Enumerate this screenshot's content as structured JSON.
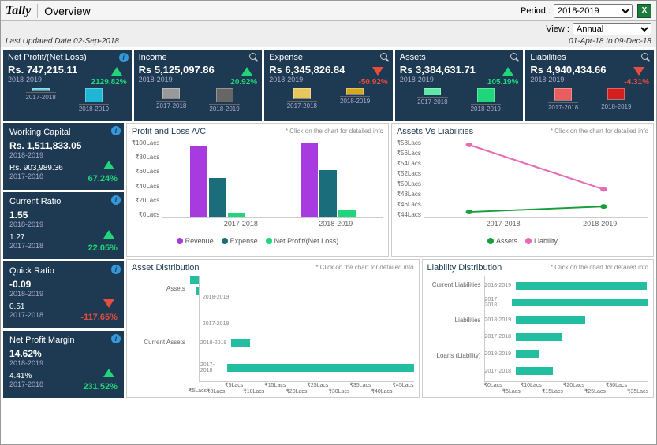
{
  "header": {
    "logo": "Tally",
    "title": "Overview",
    "period_label": "Period :",
    "period_value": "2018-2019",
    "view_label": "View :",
    "view_value": "Annual",
    "date_range": "01-Apr-18 to 09-Dec-18",
    "last_updated": "Last Updated Date 02-Sep-2018"
  },
  "top_cards": [
    {
      "title": "Net Profit/(Net Loss)",
      "value": "Rs. 747,215.11",
      "year": "2018-2019",
      "pct": "2129.82%",
      "dir": "up",
      "icon": "info",
      "bars": [
        {
          "label": "2017-2018",
          "h": 3,
          "color": "#5dd3e8"
        },
        {
          "label": "2018-2019",
          "h": 18,
          "color": "#1fb5d4"
        }
      ]
    },
    {
      "title": "Income",
      "value": "Rs 5,125,097.86",
      "year": "2018-2019",
      "pct": "20.92%",
      "dir": "up",
      "icon": "search",
      "bars": [
        {
          "label": "2017-2018",
          "h": 14,
          "color": "#999"
        },
        {
          "label": "2018-2019",
          "h": 18,
          "color": "#666"
        }
      ]
    },
    {
      "title": "Expense",
      "value": "Rs 6,345,826.84",
      "year": "2018-2019",
      "pct": "-50.92%",
      "dir": "down",
      "icon": "search",
      "bars": [
        {
          "label": "2017-2018",
          "h": 14,
          "color": "#e8c65d"
        },
        {
          "label": "2018-2019",
          "h": 8,
          "color": "#d4a81f"
        }
      ]
    },
    {
      "title": "Assets",
      "value": "Rs 3,384,631.71",
      "year": "2018-2019",
      "pct": "105.19%",
      "dir": "up",
      "icon": "search",
      "bars": [
        {
          "label": "2017-2018",
          "h": 9,
          "color": "#5de8a8"
        },
        {
          "label": "2018-2019",
          "h": 18,
          "color": "#1fd67a"
        }
      ]
    },
    {
      "title": "Liabilities",
      "value": "Rs 4,940,434.66",
      "year": "2018-2019",
      "pct": "-4.31%",
      "dir": "down",
      "icon": "search",
      "bars": [
        {
          "label": "2017-2018",
          "h": 16,
          "color": "#e85d5d"
        },
        {
          "label": "2018-2019",
          "h": 15,
          "color": "#d41f1f"
        }
      ]
    }
  ],
  "side_cards": [
    {
      "title": "Working Capital",
      "val1": "Rs. 1,511,833.05",
      "year1": "2018-2019",
      "val2": "Rs. 903,989.36",
      "year2": "2017-2018",
      "pct": "67.24%",
      "dir": "up"
    },
    {
      "title": "Current Ratio",
      "val1": "1.55",
      "year1": "2018-2019",
      "val2": "1.27",
      "year2": "2017-2018",
      "pct": "22.05%",
      "dir": "up"
    },
    {
      "title": "Quick Ratio",
      "val1": "-0.09",
      "year1": "2018-2019",
      "val2": "0.51",
      "year2": "2017-2018",
      "pct": "-117.65%",
      "dir": "down"
    },
    {
      "title": "Net Profit Margin",
      "val1": "14.62%",
      "year1": "2018-2019",
      "val2": "4.41%",
      "year2": "2017-2018",
      "pct": "231.52%",
      "dir": "up"
    }
  ],
  "chart_titles": {
    "pl": "Profit and Loss A/C",
    "avl": "Assets Vs Liabilities",
    "asset_dist": "Asset Distribution",
    "liab_dist": "Liability Distribution",
    "hint": "*  Click on  the chart for detailed info"
  },
  "legends": {
    "pl": [
      "Revenue",
      "Expense",
      "Net Profit/(Net Loss)"
    ],
    "avl": [
      "Assets",
      "Liability"
    ]
  },
  "chart_data": [
    {
      "name": "Profit and Loss A/C",
      "type": "bar",
      "categories": [
        "2017-2018",
        "2018-2019"
      ],
      "series": [
        {
          "name": "Revenue",
          "values": [
            90,
            95
          ],
          "color": "#a83be0"
        },
        {
          "name": "Expense",
          "values": [
            50,
            60
          ],
          "color": "#1a6d7a"
        },
        {
          "name": "Net Profit/(Net Loss)",
          "values": [
            5,
            10
          ],
          "color": "#1fd67a"
        }
      ],
      "ylabel": "₹Lacs",
      "ylim": [
        0,
        100
      ],
      "yticks": [
        "₹0Lacs",
        "₹20Lacs",
        "₹40Lacs",
        "₹60Lacs",
        "₹80Lacs",
        "₹100Lacs"
      ]
    },
    {
      "name": "Assets Vs Liabilities",
      "type": "line",
      "categories": [
        "2017-2018",
        "2018-2019"
      ],
      "series": [
        {
          "name": "Assets",
          "values": [
            45,
            46
          ],
          "color": "#1a9e3c"
        },
        {
          "name": "Liability",
          "values": [
            57,
            49
          ],
          "color": "#e86bb8"
        }
      ],
      "ylabel": "₹Lacs",
      "ylim": [
        44,
        58
      ],
      "yticks": [
        "₹44Lacs",
        "₹46Lacs",
        "₹48Lacs",
        "₹50Lacs",
        "₹52Lacs",
        "₹54Lacs",
        "₹56Lacs",
        "₹58Lacs"
      ]
    },
    {
      "name": "Asset Distribution",
      "type": "bar",
      "orientation": "horizontal",
      "categories": [
        "Assets 2018-2019",
        "Assets 2017-2018",
        "Current Assets 2018-2019",
        "Current Assets 2017-2018"
      ],
      "values": [
        -4,
        -1,
        4,
        45
      ],
      "xlabel": "₹Lacs",
      "xlim": [
        -5,
        45
      ],
      "xticks": [
        "-₹5Lacs",
        "₹0Lacs",
        "₹5Lacs",
        "₹10Lacs",
        "₹15Lacs",
        "₹20Lacs",
        "₹25Lacs",
        "₹30Lacs",
        "₹35Lacs",
        "₹40Lacs",
        "₹45Lacs"
      ]
    },
    {
      "name": "Liability Distribution",
      "type": "bar",
      "orientation": "horizontal",
      "categories": [
        "Current Liabilities 2018-2019",
        "Current Liabilities 2017-2018",
        "Liabilities 2018-2019",
        "Liabilities 2017-2018",
        "Loans (Liability) 2018-2019",
        "Loans (Liability) 2017-2018"
      ],
      "values": [
        28,
        33,
        15,
        10,
        5,
        8
      ],
      "xlabel": "₹Lacs",
      "xlim": [
        0,
        35
      ],
      "xticks": [
        "₹0Lacs",
        "₹5Lacs",
        "₹10Lacs",
        "₹15Lacs",
        "₹20Lacs",
        "₹25Lacs",
        "₹30Lacs",
        "₹35Lacs"
      ]
    }
  ]
}
